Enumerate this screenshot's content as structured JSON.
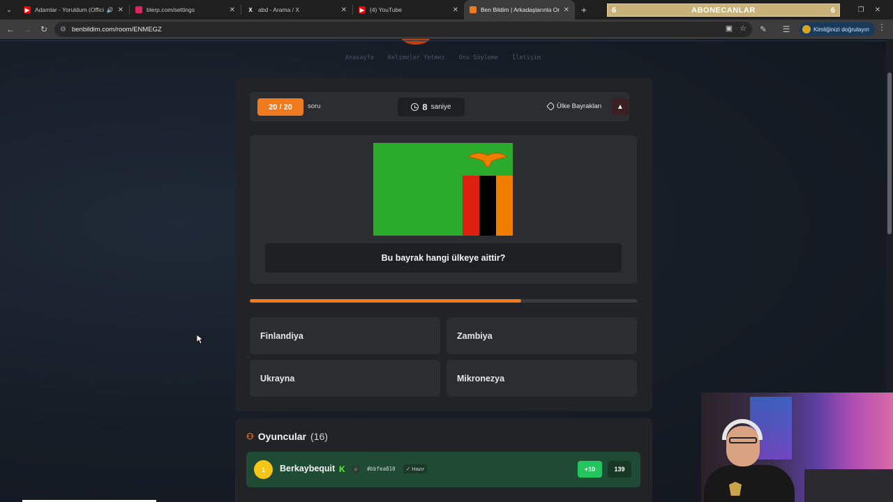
{
  "browser": {
    "tabs": [
      {
        "title": "Adamlar - Yoruldum (Official",
        "favicon_color": "#ff0000",
        "audio": true,
        "active": false
      },
      {
        "title": "blerp.com/settings",
        "favicon_color": "#e0245e",
        "audio": false,
        "active": false
      },
      {
        "title": "abd - Arama / X",
        "favicon_color": "#000000",
        "audio": false,
        "active": false
      },
      {
        "title": "(4) YouTube",
        "favicon_color": "#ff0000",
        "audio": false,
        "active": false
      },
      {
        "title": "Ben Bildim | Arkadaşlarınla Onl",
        "favicon_color": "#f07b1f",
        "audio": false,
        "active": true
      }
    ],
    "url": "benbildim.com/room/ENMEGZ",
    "identity_chip": "Kimliğinizi doğrulayın"
  },
  "stream_overlay": {
    "label": "ABONECANLAR",
    "left_count": "6",
    "right_count": "6"
  },
  "site_nav": [
    "Anasayfa",
    "Kelimeler Yetmez",
    "Onu Söyleme",
    "İletişim"
  ],
  "game": {
    "question_counter": "20 / 20",
    "question_suffix": "soru",
    "timer_value": "8",
    "timer_unit": "saniye",
    "category": "Ülke Bayrakları",
    "report_icon": "warning-icon",
    "flag": "zambia-flag",
    "question": "Bu bayrak hangi ülkeye aittir?",
    "progress_fraction": 0.7,
    "answers": [
      "Finlandiya",
      "Zambiya",
      "Ukrayna",
      "Mikronezya"
    ],
    "accent_color": "#f07b1f"
  },
  "players": {
    "title": "Oyuncular",
    "count": "(16)",
    "list": [
      {
        "rank": "1",
        "name": "Berkaybequit",
        "tag": "#bbfea810",
        "status": "Hazır",
        "gain": "+10",
        "score": "139"
      }
    ]
  }
}
